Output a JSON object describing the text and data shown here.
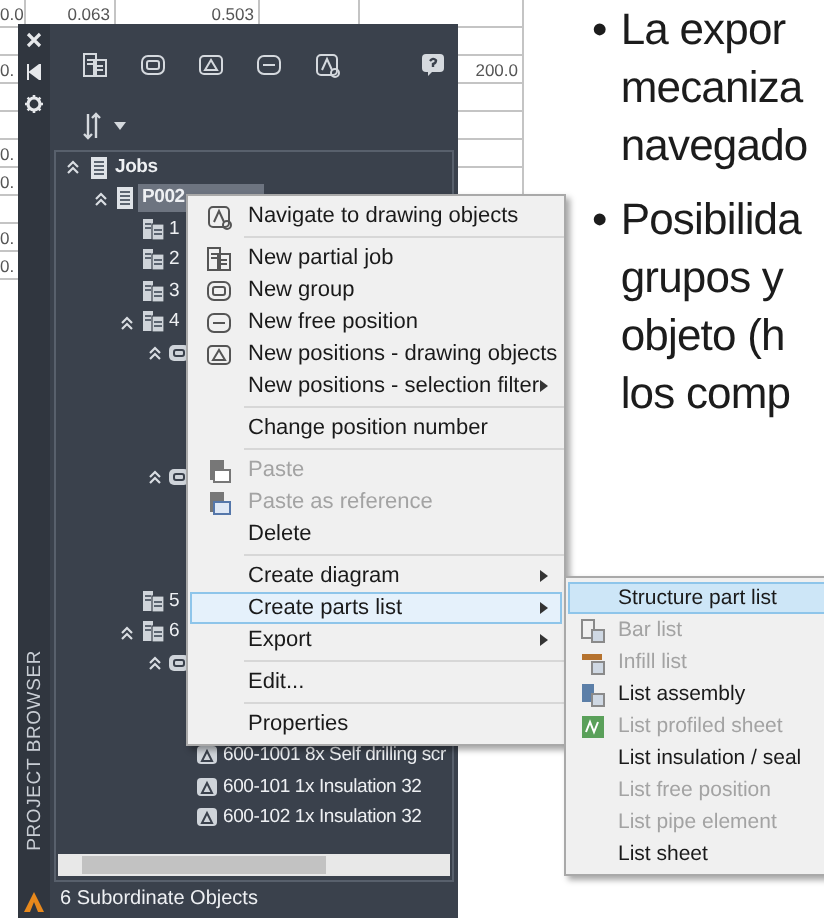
{
  "sheet": {
    "rows": [
      [
        "0.0",
        "0.063",
        "0.503",
        "",
        ""
      ],
      [
        "",
        "",
        "",
        "",
        ""
      ],
      [
        "0.",
        "",
        "",
        "",
        "200.0"
      ],
      [
        "",
        "",
        "",
        "",
        ""
      ],
      [
        "",
        "",
        "",
        "",
        ""
      ],
      [
        "0.",
        "",
        "",
        "",
        ""
      ],
      [
        "0.",
        "",
        "",
        "",
        ""
      ],
      [
        "",
        "",
        "",
        "",
        ""
      ],
      [
        "0.",
        "",
        "",
        "",
        ""
      ],
      [
        "0.",
        "",
        "",
        "",
        ""
      ]
    ]
  },
  "document": {
    "bullets": [
      {
        "bullet": "•",
        "lines": [
          "La expor",
          "mecaniza",
          "navegado"
        ]
      },
      {
        "bullet": "•",
        "lines": [
          "Posibilida",
          "grupos y",
          "objeto (h",
          "los comp"
        ]
      }
    ]
  },
  "panel": {
    "title": "PROJECT BROWSER",
    "toolbar": [
      {
        "kind": "partial-job"
      },
      {
        "kind": "group"
      },
      {
        "kind": "positions"
      },
      {
        "kind": "free-position"
      },
      {
        "kind": "navigate"
      },
      {
        "kind": "help"
      }
    ],
    "tree": [
      {
        "kind": "job",
        "label": "Jobs",
        "selected": false,
        "expanded": true,
        "children": [
          {
            "kind": "job",
            "label": "P002",
            "selected": true,
            "expanded": true,
            "children": [
              {
                "kind": "partial",
                "label": "1",
                "selected": false
              },
              {
                "kind": "partial",
                "label": "2",
                "selected": false
              },
              {
                "kind": "partial",
                "label": "3",
                "selected": false
              },
              {
                "kind": "partial",
                "label": "4",
                "selected": false,
                "expanded": true,
                "children": [
                  {
                    "kind": "group",
                    "expanded": true,
                    "children": [
                      {
                        "kind": "position"
                      },
                      {
                        "kind": "position"
                      },
                      {
                        "kind": "position"
                      }
                    ]
                  },
                  {
                    "kind": "group",
                    "expanded": true,
                    "children": [
                      {
                        "kind": "position"
                      },
                      {
                        "kind": "position"
                      },
                      {
                        "kind": "position"
                      }
                    ]
                  }
                ]
              },
              {
                "kind": "partial",
                "label": "5",
                "selected": false
              },
              {
                "kind": "partial",
                "label": "6",
                "selected": false,
                "expanded": true,
                "children": [
                  {
                    "kind": "group",
                    "expanded": true,
                    "children": [
                      {
                        "kind": "position"
                      },
                      {
                        "kind": "position"
                      },
                      {
                        "kind": "position",
                        "label": "600-1001 8x Self drilling scr",
                        "selected": false
                      },
                      {
                        "kind": "position",
                        "label": "600-101 1x Insulation 32",
                        "selected": false
                      },
                      {
                        "kind": "position",
                        "label": "600-102 1x Insulation 32",
                        "selected": false
                      }
                    ]
                  }
                ]
              }
            ]
          }
        ]
      }
    ],
    "status": "6 Subordinate Objects"
  },
  "context_menu": {
    "items": [
      {
        "kind": "navigate",
        "label": "Navigate to drawing objects",
        "disabled": false,
        "selected": false,
        "submenu": false
      },
      {
        "kind": "separator"
      },
      {
        "kind": "partial-job",
        "label": "New partial job",
        "disabled": false,
        "selected": false,
        "submenu": false
      },
      {
        "kind": "group",
        "label": "New group",
        "disabled": false,
        "selected": false,
        "submenu": false
      },
      {
        "kind": "free-position",
        "label": "New free position",
        "disabled": false,
        "selected": false,
        "submenu": false
      },
      {
        "kind": "positions",
        "label": "New positions - drawing objects",
        "disabled": false,
        "selected": false,
        "submenu": false
      },
      {
        "kind": "plain",
        "label": "New positions - selection filter",
        "disabled": false,
        "selected": false,
        "submenu": true
      },
      {
        "kind": "separator"
      },
      {
        "kind": "plain",
        "label": "Change position number",
        "disabled": false,
        "selected": false,
        "submenu": false
      },
      {
        "kind": "separator"
      },
      {
        "kind": "paste",
        "label": "Paste",
        "disabled": true,
        "selected": false,
        "submenu": false
      },
      {
        "kind": "paste-ref",
        "label": "Paste as reference",
        "disabled": true,
        "selected": false,
        "submenu": false
      },
      {
        "kind": "plain",
        "label": "Delete",
        "disabled": false,
        "selected": false,
        "submenu": false
      },
      {
        "kind": "separator"
      },
      {
        "kind": "plain",
        "label": "Create diagram",
        "disabled": false,
        "selected": false,
        "submenu": true
      },
      {
        "kind": "plain",
        "label": "Create parts list",
        "disabled": false,
        "selected": true,
        "submenu": true
      },
      {
        "kind": "plain",
        "label": "Export",
        "disabled": false,
        "selected": false,
        "submenu": true
      },
      {
        "kind": "separator"
      },
      {
        "kind": "plain",
        "label": "Edit...",
        "disabled": false,
        "selected": false,
        "submenu": false
      },
      {
        "kind": "separator"
      },
      {
        "kind": "plain",
        "label": "Properties",
        "disabled": false,
        "selected": false,
        "submenu": false
      }
    ]
  },
  "submenu": {
    "items": [
      {
        "kind": "plain",
        "label": "Structure part list",
        "disabled": false,
        "selected": true
      },
      {
        "kind": "bar",
        "label": "Bar list",
        "disabled": true,
        "selected": false
      },
      {
        "kind": "infill",
        "label": "Infill list",
        "disabled": true,
        "selected": false
      },
      {
        "kind": "assembly",
        "label": "List assembly",
        "disabled": false,
        "selected": false
      },
      {
        "kind": "profiled",
        "label": "List profiled sheet",
        "disabled": true,
        "selected": false
      },
      {
        "kind": "plain",
        "label": "List insulation / seal",
        "disabled": false,
        "selected": false
      },
      {
        "kind": "plain",
        "label": "List free position",
        "disabled": true,
        "selected": false
      },
      {
        "kind": "plain",
        "label": "List pipe element",
        "disabled": true,
        "selected": false
      },
      {
        "kind": "plain",
        "label": "List sheet",
        "disabled": false,
        "selected": false
      }
    ]
  }
}
